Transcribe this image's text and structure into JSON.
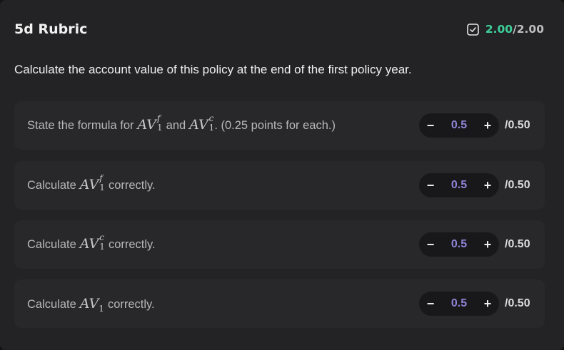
{
  "header": {
    "title": "5d Rubric",
    "score_earned": "2.00",
    "score_separator": "/",
    "score_total": "2.00"
  },
  "question": "Calculate the account value of this policy at the end of the first policy year.",
  "criteria": [
    {
      "prefix": "State the formula for",
      "math1": {
        "base": "AV",
        "sub": "1",
        "sup": "f"
      },
      "middle": "and",
      "math2": {
        "base": "AV",
        "sub": "1",
        "sup": "c"
      },
      "suffix": ". (0.25 points for each.)",
      "value": "0.5",
      "max": "/0.50"
    },
    {
      "prefix": "Calculate",
      "math1": {
        "base": "AV",
        "sub": "1",
        "sup": "f"
      },
      "suffix": "correctly.",
      "value": "0.5",
      "max": "/0.50"
    },
    {
      "prefix": "Calculate",
      "math1": {
        "base": "AV",
        "sub": "1",
        "sup": "c"
      },
      "suffix": "correctly.",
      "value": "0.5",
      "max": "/0.50"
    },
    {
      "prefix": "Calculate",
      "math1": {
        "base": "AV",
        "sub": "1",
        "sup": ""
      },
      "suffix": "correctly.",
      "value": "0.5",
      "max": "/0.50"
    }
  ],
  "stepper": {
    "minus": "−",
    "plus": "+"
  },
  "colors": {
    "accent_green": "#3ecf9a",
    "accent_purple": "#8f84d8",
    "panel": "#232325",
    "item": "#28282a"
  },
  "icons": {
    "score": "checkbox-check-icon"
  }
}
